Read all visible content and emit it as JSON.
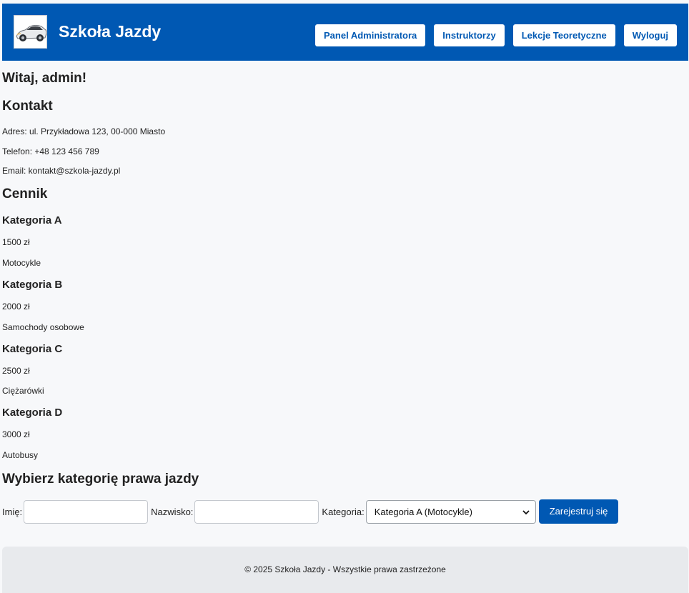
{
  "header": {
    "logo_icon": "sports-car-icon",
    "title": "Szkoła Jazdy",
    "nav": [
      {
        "label": "Panel Administratora"
      },
      {
        "label": "Instruktorzy"
      },
      {
        "label": "Lekcje Teoretyczne"
      },
      {
        "label": "Wyloguj"
      }
    ]
  },
  "main": {
    "welcome": "Witaj, admin!",
    "contact": {
      "heading": "Kontakt",
      "address": "Adres: ul. Przykładowa 123, 00-000 Miasto",
      "phone": "Telefon: +48 123 456 789",
      "email": "Email: kontakt@szkola-jazdy.pl"
    },
    "pricing": {
      "heading": "Cennik",
      "categories": [
        {
          "name": "Kategoria A",
          "price": "1500 zł",
          "desc": "Motocykle"
        },
        {
          "name": "Kategoria B",
          "price": "2000 zł",
          "desc": "Samochody osobowe"
        },
        {
          "name": "Kategoria C",
          "price": "2500 zł",
          "desc": "Ciężarówki"
        },
        {
          "name": "Kategoria D",
          "price": "3000 zł",
          "desc": "Autobusy"
        }
      ]
    },
    "form": {
      "heading": "Wybierz kategorię prawa jazdy",
      "first_name_label": "Imię:",
      "first_name_value": "",
      "last_name_label": "Nazwisko:",
      "last_name_value": "",
      "category_label": "Kategoria:",
      "category_selected": "Kategoria A (Motocykle)",
      "submit_label": "Zarejestruj się"
    }
  },
  "footer": {
    "text": "© 2025 Szkoła Jazdy - Wszystkie prawa zastrzeżone"
  },
  "colors": {
    "brand_blue": "#0058b3",
    "page_bg": "#f7f8fa",
    "footer_bg": "#e8eaed"
  }
}
